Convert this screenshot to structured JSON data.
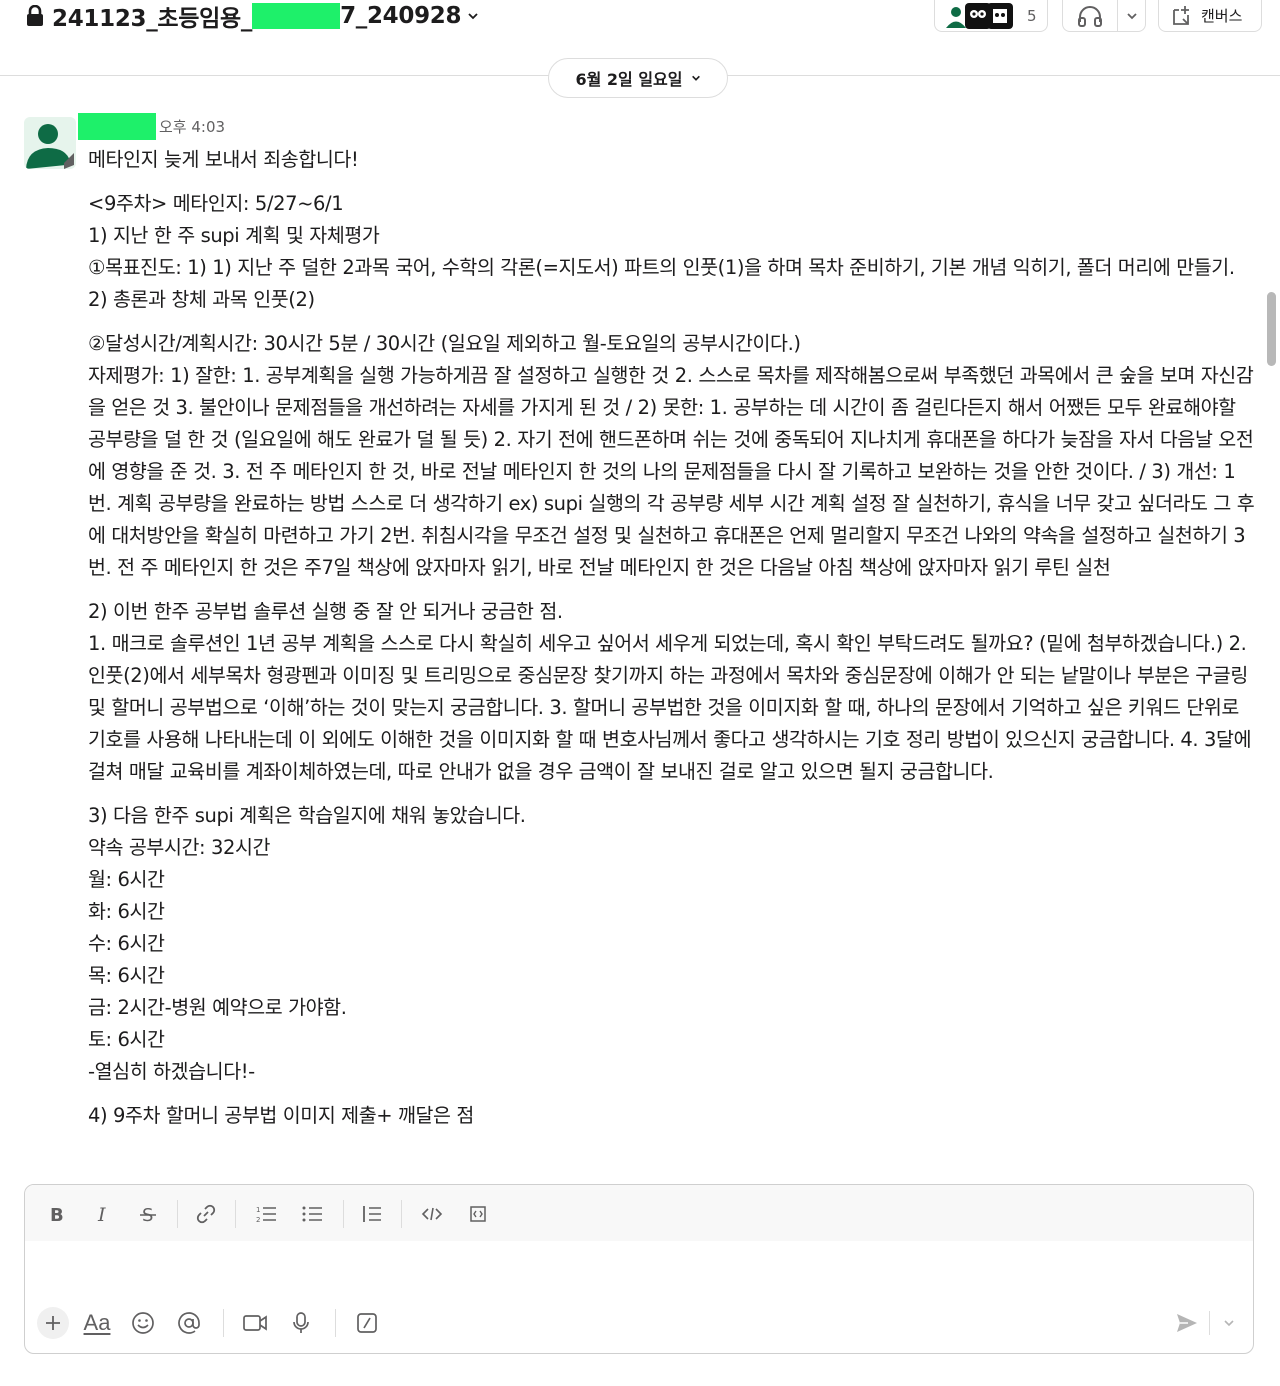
{
  "header": {
    "channel_name_prefix": "241123_초등임용_",
    "channel_name_suffix": "7_240928",
    "member_count": "5",
    "canvas_label": "캔버스"
  },
  "date_divider": {
    "label": "6월 2일 일요일"
  },
  "message": {
    "time": "오후 4:03",
    "lines": [
      "메타인지 늦게 보내서 죄송합니다!",
      "<9주차> 메타인지: 5/27~6/1",
      "1) 지난 한 주 supi 계획 및 자체평가",
      "①목표진도: 1) 1) 지난 주 덜한 2과목 국어, 수학의 각론(=지도서) 파트의 인풋(1)을 하며 목차 준비하기, 기본 개념 익히기, 폴더 머리에 만들기. 2) 총론과 창체 과목 인풋(2)",
      "②달성시간/계획시간: 30시간 5분 / 30시간 (일요일 제외하고 월-토요일의 공부시간이다.)",
      "자제평가: 1) 잘한: 1. 공부계획을 실행 가능하게끔 잘 설정하고 실행한 것 2. 스스로 목차를 제작해봄으로써 부족했던 과목에서 큰 숲을 보며 자신감을 얻은 것 3. 불안이나 문제점들을 개선하려는 자세를 가지게 된 것 / 2) 못한: 1. 공부하는 데 시간이 좀 걸린다든지 해서 어쨌든 모두 완료해야할 공부량을 덜 한 것 (일요일에 해도 완료가 덜 될 듯) 2. 자기 전에 핸드폰하며 쉬는 것에 중독되어 지나치게 휴대폰을 하다가 늦잠을 자서 다음날 오전에 영향을 준 것. 3. 전 주 메타인지 한 것, 바로 전날 메타인지 한 것의 나의 문제점들을 다시 잘 기록하고 보완하는 것을 안한 것이다. / 3) 개선: 1번. 계획 공부량을 완료하는 방법 스스로 더 생각하기 ex) supi 실행의 각 공부량 세부 시간 계획 설정 잘 실천하기, 휴식을 너무 갖고 싶더라도 그 후에 대처방안을 확실히 마련하고 가기 2번. 취침시각을 무조건 설정 및 실천하고 휴대폰은 언제 멀리할지 무조건 나와의 약속을 설정하고 실천하기 3번. 전 주 메타인지 한 것은 주7일 책상에 앉자마자 읽기, 바로 전날 메타인지 한 것은 다음날 아침 책상에 앉자마자 읽기 루틴 실천",
      "2) 이번 한주 공부법 솔루션 실행 중 잘 안 되거나 궁금한 점.",
      "1. 매크로 솔루션인 1년 공부 계획을 스스로 다시 확실히 세우고 싶어서 세우게 되었는데, 혹시 확인 부탁드려도 될까요? (밑에 첨부하겠습니다.) 2. 인풋(2)에서 세부목차 형광펜과 이미징 및 트리밍으로 중심문장 찾기까지 하는 과정에서 목차와 중심문장에 이해가 안 되는 낱말이나 부분은 구글링 및 할머니 공부법으로 ‘이해’하는 것이 맞는지 궁금합니다. 3. 할머니 공부법한 것을 이미지화 할 때, 하나의 문장에서 기억하고 싶은 키워드 단위로 기호를 사용해 나타내는데 이 외에도 이해한 것을 이미지화 할 때 변호사님께서 좋다고 생각하시는 기호 정리 방법이 있으신지 궁금합니다. 4. 3달에 걸쳐 매달 교육비를 계좌이체하였는데, 따로 안내가 없을 경우 금액이 잘 보내진 걸로 알고 있으면 될지 궁금합니다.",
      "3) 다음 한주 supi 계획은 학습일지에 채워 놓았습니다.",
      "약속 공부시간: 32시간",
      "월: 6시간",
      "화: 6시간",
      "수: 6시간",
      "목: 6시간",
      "금: 2시간-병원 예약으로 가야함.",
      "토: 6시간",
      "-열심히 하겠습니다!-",
      "4) 9주차 할머니 공부법 이미지 제출+ 깨달은 점"
    ]
  },
  "composer": {
    "placeholder": "",
    "aa_label": "Aa"
  },
  "colors": {
    "redaction": "#1ef06a",
    "avatar_bg": "#0e6b45",
    "avatar_fg": "#e6f4ec"
  }
}
